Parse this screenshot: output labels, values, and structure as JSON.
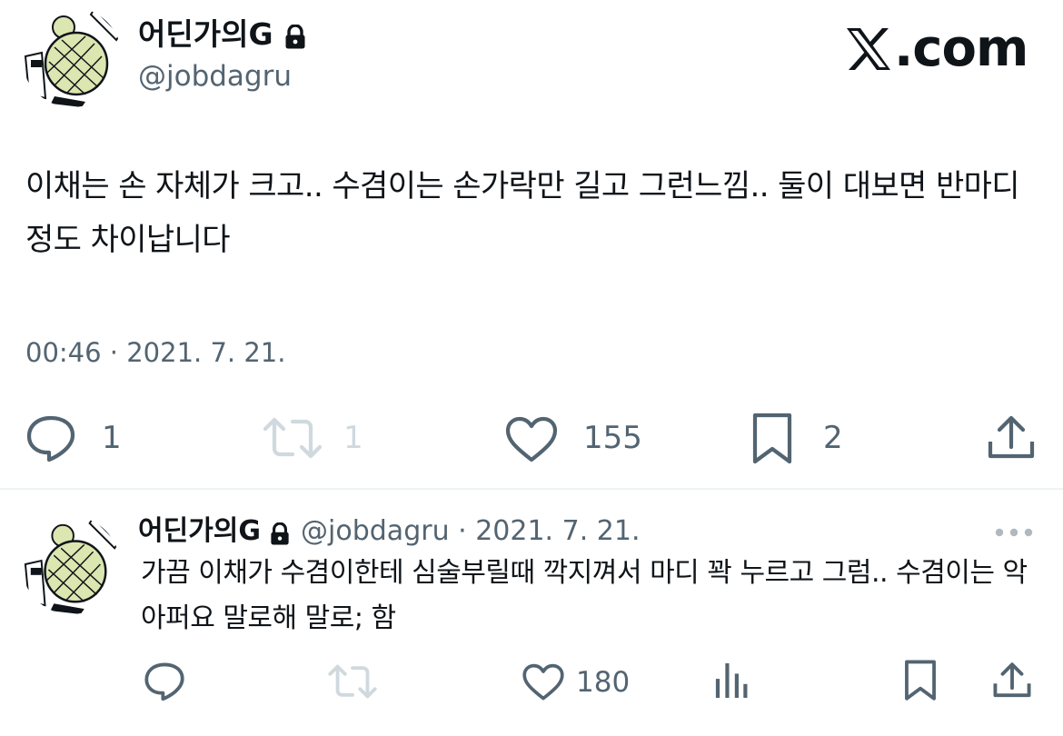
{
  "main": {
    "author_name": "어딘가의G",
    "author_handle": "@jobdagru",
    "brand_text": ".com",
    "text": "이채는 손 자체가 크고.. 수겸이는 손가락만 길고 그런느낌.. 둘이 대보면 반마디정도 차이납니다",
    "timestamp": "00:46 · 2021. 7. 21.",
    "actions": {
      "reply_count": "1",
      "retweet_count": "1",
      "like_count": "155",
      "bookmark_count": "2"
    }
  },
  "reply": {
    "author_name": "어딘가의G",
    "meta": "@jobdagru · 2021. 7. 21.",
    "text": "가끔 이채가 수겸이한테 심술부릴때 깍지껴서 마디 꽉 누르고 그럼.. 수겸이는 악 아퍼요 말로해 말로; 함",
    "actions": {
      "like_count": "180"
    }
  },
  "icons": {
    "reply": "reply-icon",
    "retweet": "retweet-icon",
    "like": "heart-icon",
    "bookmark": "bookmark-icon",
    "share": "share-icon",
    "views": "views-icon",
    "more": "more-icon",
    "lock": "lock-icon",
    "logo": "x-logo-icon"
  },
  "colors": {
    "text": "#0f1419",
    "secondary": "#536471",
    "muted": "#cfd9de",
    "divider": "#eff3f4",
    "avatar_shell": "#dbe6b0"
  }
}
